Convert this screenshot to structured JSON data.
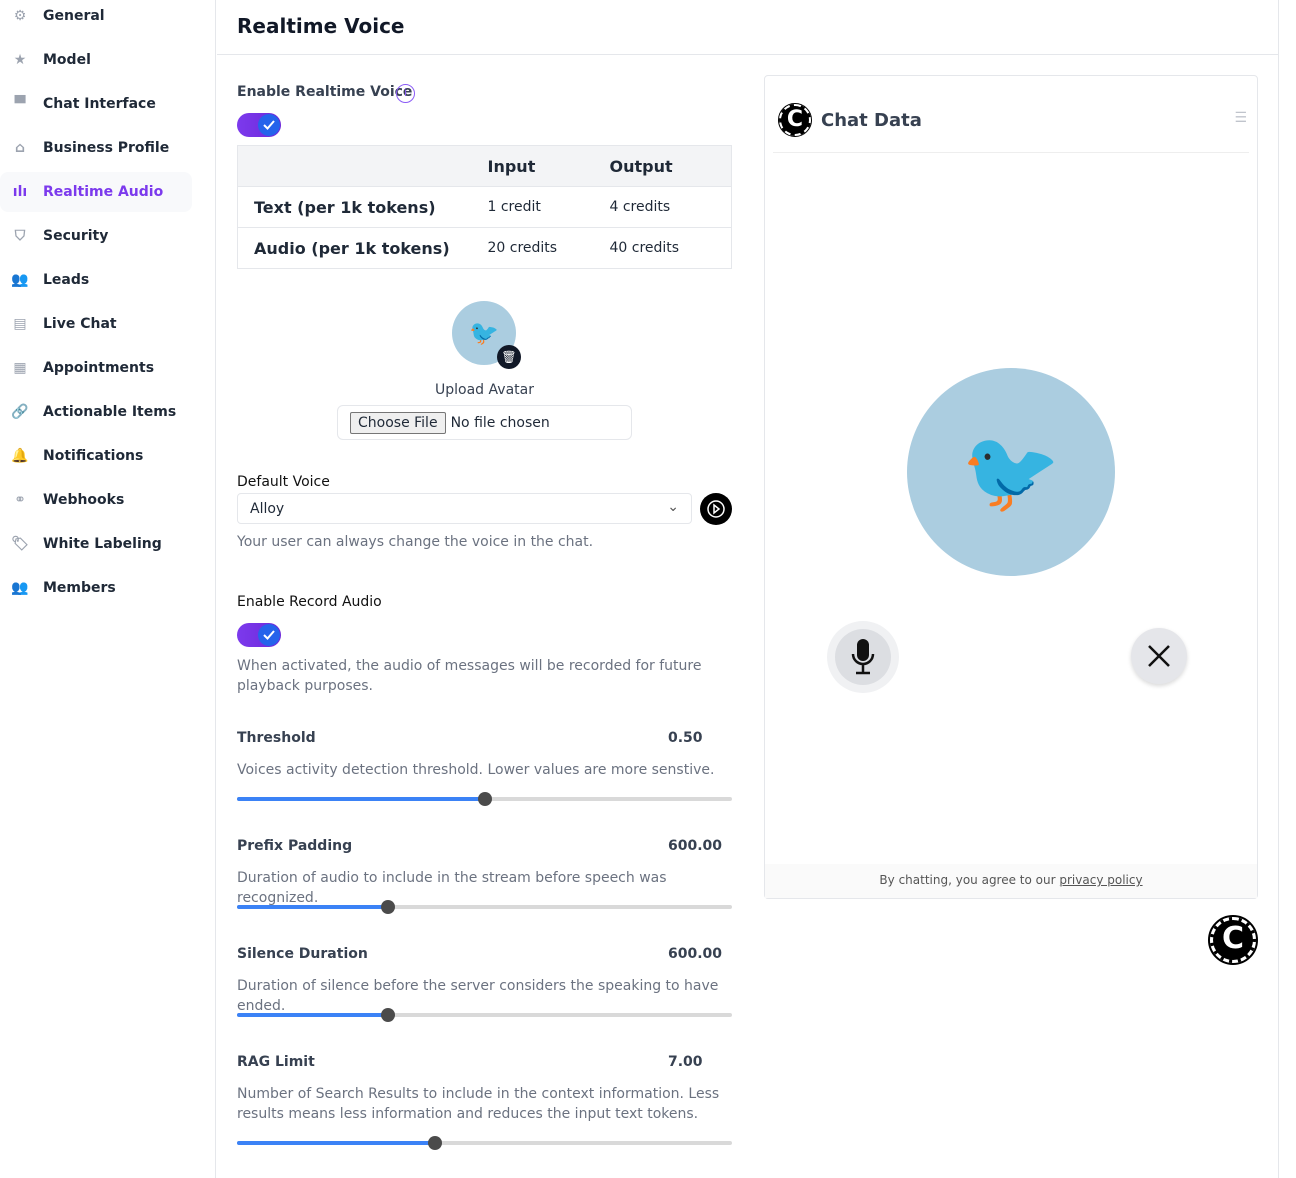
{
  "sidebar": {
    "active": "Realtime Audio",
    "items": [
      {
        "label": "General",
        "icon": "gear-icon"
      },
      {
        "label": "Model",
        "icon": "star-icon"
      },
      {
        "label": "Chat Interface",
        "icon": "monitor-icon"
      },
      {
        "label": "Business Profile",
        "icon": "home-icon"
      },
      {
        "label": "Realtime Audio",
        "icon": "audio-wave-icon"
      },
      {
        "label": "Security",
        "icon": "shield-icon"
      },
      {
        "label": "Leads",
        "icon": "users-icon"
      },
      {
        "label": "Live Chat",
        "icon": "chat-icon"
      },
      {
        "label": "Appointments",
        "icon": "calendar-icon"
      },
      {
        "label": "Actionable Items",
        "icon": "link-icon"
      },
      {
        "label": "Notifications",
        "icon": "bell-icon"
      },
      {
        "label": "Webhooks",
        "icon": "webhook-icon"
      },
      {
        "label": "White Labeling",
        "icon": "tag-icon"
      },
      {
        "label": "Members",
        "icon": "members-icon"
      }
    ]
  },
  "header": {
    "title": "Realtime Voice"
  },
  "realtime": {
    "label": "Enable Realtime Voice",
    "enabled": true
  },
  "pricing": {
    "headers": [
      "",
      "Input",
      "Output"
    ],
    "rows": [
      [
        "Text (per 1k tokens)",
        "1 credit",
        "4 credits"
      ],
      [
        "Audio (per 1k tokens)",
        "20 credits",
        "40 credits"
      ]
    ]
  },
  "avatar": {
    "label": "Upload Avatar",
    "choose": "Choose File",
    "no_file": "No file chosen"
  },
  "voice": {
    "label": "Default Voice",
    "value": "Alloy",
    "help": "Your user can always change the voice in the chat."
  },
  "record": {
    "label": "Enable Record Audio",
    "enabled": true,
    "help": "When activated, the audio of messages will be recorded for future playback purposes."
  },
  "sliders": [
    {
      "label": "Threshold",
      "value": "0.50",
      "help": "Voices activity detection threshold. Lower values are more senstive.",
      "percent": 50
    },
    {
      "label": "Prefix Padding",
      "value": "600.00",
      "help": "Duration of audio to include in the stream before speech was recognized.",
      "percent": 30.5
    },
    {
      "label": "Silence Duration",
      "value": "600.00",
      "help": "Duration of silence before the server considers the speaking to have ended.",
      "percent": 30.5
    },
    {
      "label": "RAG Limit",
      "value": "7.00",
      "help": "Number of Search Results to include in the context information. Less results means less information and reduces the input text tokens.",
      "percent": 40
    }
  ],
  "preview": {
    "title": "Chat Data",
    "footer": "By chatting, you agree to our ",
    "policy": "privacy policy"
  },
  "colors": {
    "accent": "#7c3aed",
    "toggle_knob": "#2563eb",
    "slider_fill": "#3b82f6",
    "avatar_bg": "#abcde0"
  }
}
